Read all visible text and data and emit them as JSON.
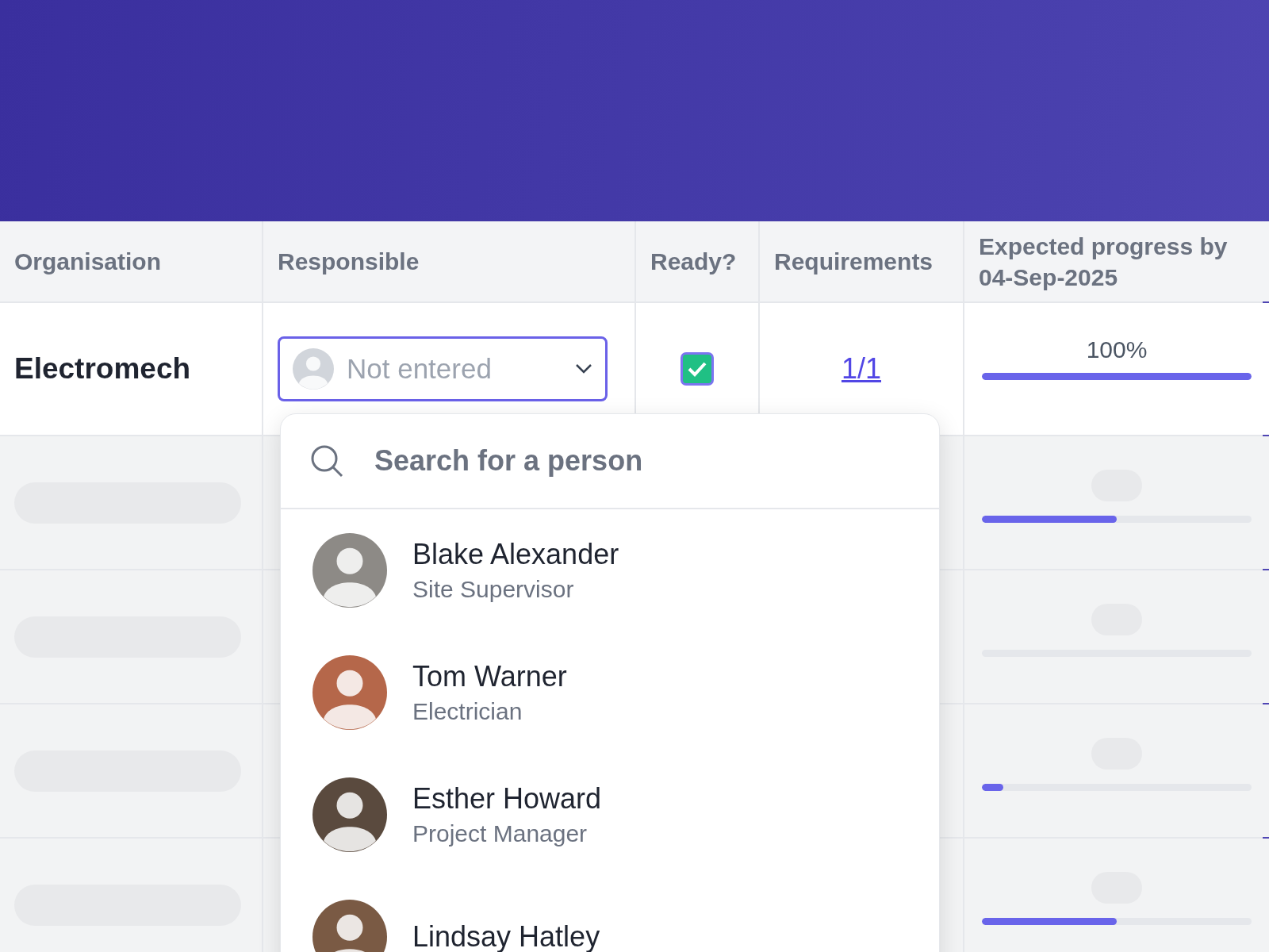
{
  "table": {
    "columns": [
      "Organisation",
      "Responsible",
      "Ready?",
      "Requirements",
      "Expected progress by 04-Sep-2025"
    ],
    "row": {
      "organisation": "Electromech",
      "responsible": {
        "placeholder": "Not entered",
        "expanded": true
      },
      "ready": {
        "checked": true
      },
      "requirements": "1/1",
      "progress": {
        "reading": "100%",
        "level": 1
      }
    },
    "loading_rows": [
      {
        "level": 0.5
      },
      {},
      {
        "level": 0.08
      },
      {
        "level": 0.5
      }
    ]
  },
  "person_picker": {
    "search": {
      "placeholder": "Search for a person"
    },
    "people": [
      {
        "name": "Blake Alexander",
        "role": "Site Supervisor"
      },
      {
        "name": "Tom Warner",
        "role": "Electrician"
      },
      {
        "name": "Esther Howard",
        "role": "Project Manager"
      },
      {
        "name": "Lindsay Hatley"
      }
    ]
  }
}
